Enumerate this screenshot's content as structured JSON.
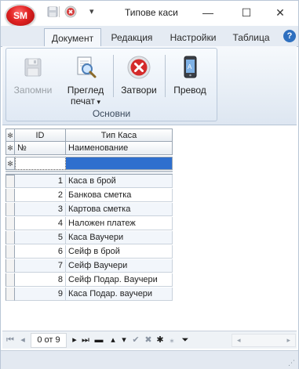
{
  "app": {
    "logo_text": "SM",
    "title": "Типове каси"
  },
  "window_controls": {
    "minimize": "—",
    "maximize": "☐",
    "close": "✕"
  },
  "tabs": [
    {
      "label": "Документ",
      "active": true
    },
    {
      "label": "Редакция",
      "active": false
    },
    {
      "label": "Настройки",
      "active": false
    },
    {
      "label": "Таблица",
      "active": false
    }
  ],
  "help_label": "?",
  "ribbon": {
    "group_label": "Основни",
    "buttons": [
      {
        "label": "Запомни",
        "icon": "floppy-disk-icon",
        "enabled": false
      },
      {
        "label": "Преглед\nпечат",
        "icon": "print-preview-icon",
        "enabled": true,
        "dropdown": true
      },
      {
        "label": "Затвори",
        "icon": "close-circle-icon",
        "enabled": true
      },
      {
        "label": "Превод",
        "icon": "translate-phone-icon",
        "enabled": true
      }
    ]
  },
  "grid": {
    "header_row1": {
      "id": "ID",
      "type": "Тип Каса"
    },
    "header_row2": {
      "id": "№",
      "type": "Наименование"
    },
    "rows": [
      {
        "id": "1",
        "name": "Каса в брой"
      },
      {
        "id": "2",
        "name": "Банкова сметка"
      },
      {
        "id": "3",
        "name": "Картова сметка"
      },
      {
        "id": "4",
        "name": "Наложен платеж"
      },
      {
        "id": "5",
        "name": "Каса Ваучери"
      },
      {
        "id": "6",
        "name": "Сейф в брой"
      },
      {
        "id": "7",
        "name": "Сейф Ваучери"
      },
      {
        "id": "8",
        "name": "Сейф Подар. Ваучери"
      },
      {
        "id": "9",
        "name": "Каса Подар. ваучери"
      }
    ]
  },
  "navigator": {
    "position": "0 от 9"
  },
  "colors": {
    "accent_tab_border": "#aebdd1",
    "filter_cell": "#2f6fce",
    "logo_red": "#e02222"
  }
}
